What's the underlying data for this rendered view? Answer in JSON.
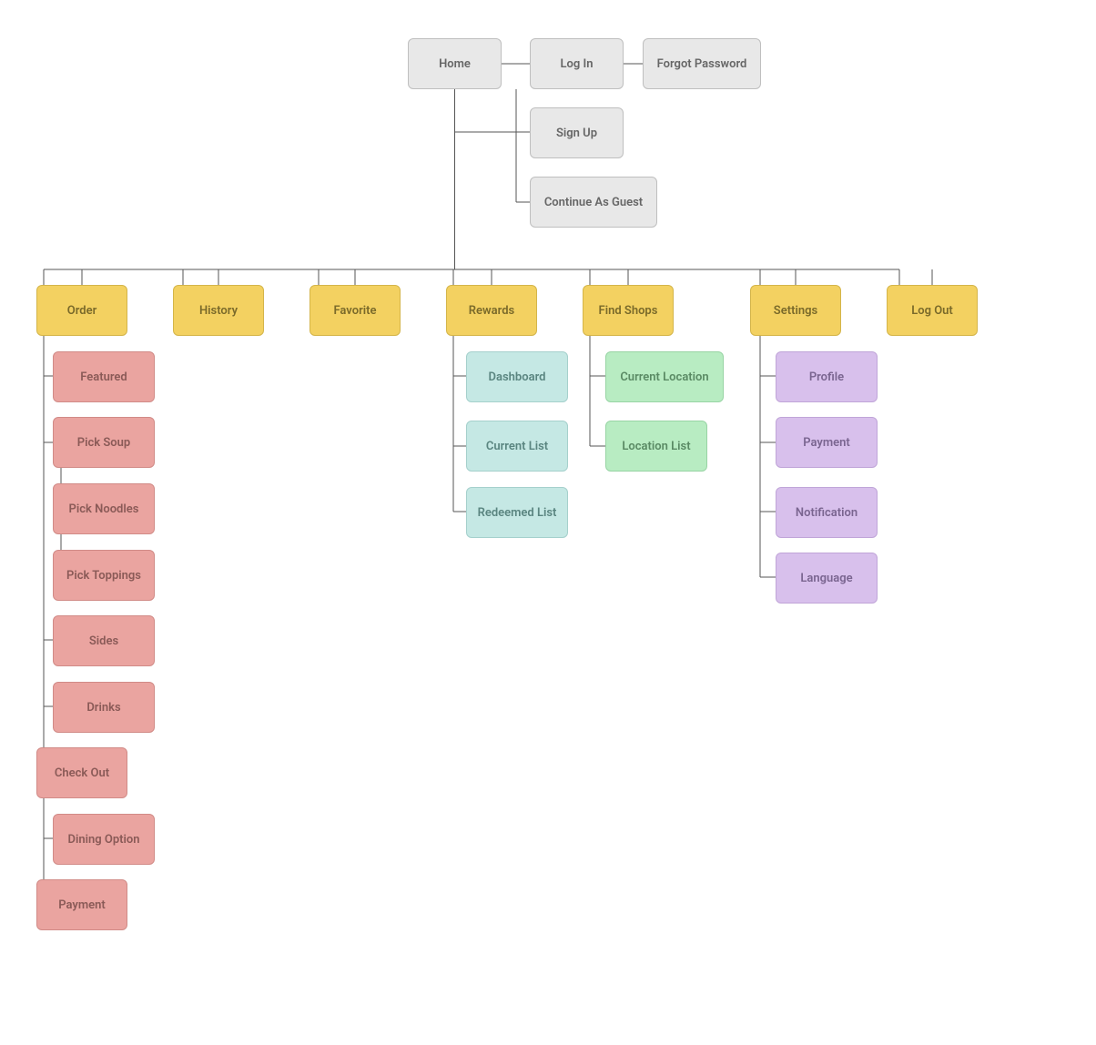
{
  "home": {
    "label": "Home",
    "auth": {
      "login": "Log In",
      "signup": "Sign Up",
      "guest": "Continue As Guest",
      "forgot": "Forgot Password"
    }
  },
  "main_nav": {
    "order": "Order",
    "history": "History",
    "favorite": "Favorite",
    "rewards": "Rewards",
    "find_shops": "Find Shops",
    "settings": "Settings",
    "logout": "Log Out"
  },
  "order": {
    "featured": "Featured",
    "pick_soup": "Pick Soup",
    "pick_noodles": "Pick Noodles",
    "pick_toppings": "Pick Toppings",
    "sides": "Sides",
    "drinks": "Drinks",
    "check_out": "Check Out",
    "dining_option": "Dining Option",
    "payment": "Payment"
  },
  "rewards": {
    "dashboard": "Dashboard",
    "current_list": "Current List",
    "redeemed_list": "Redeemed List"
  },
  "find_shops": {
    "current_location": "Current Location",
    "location_list": "Location List"
  },
  "settings": {
    "profile": "Profile",
    "payment": "Payment",
    "notification": "Notification",
    "language": "Language"
  }
}
